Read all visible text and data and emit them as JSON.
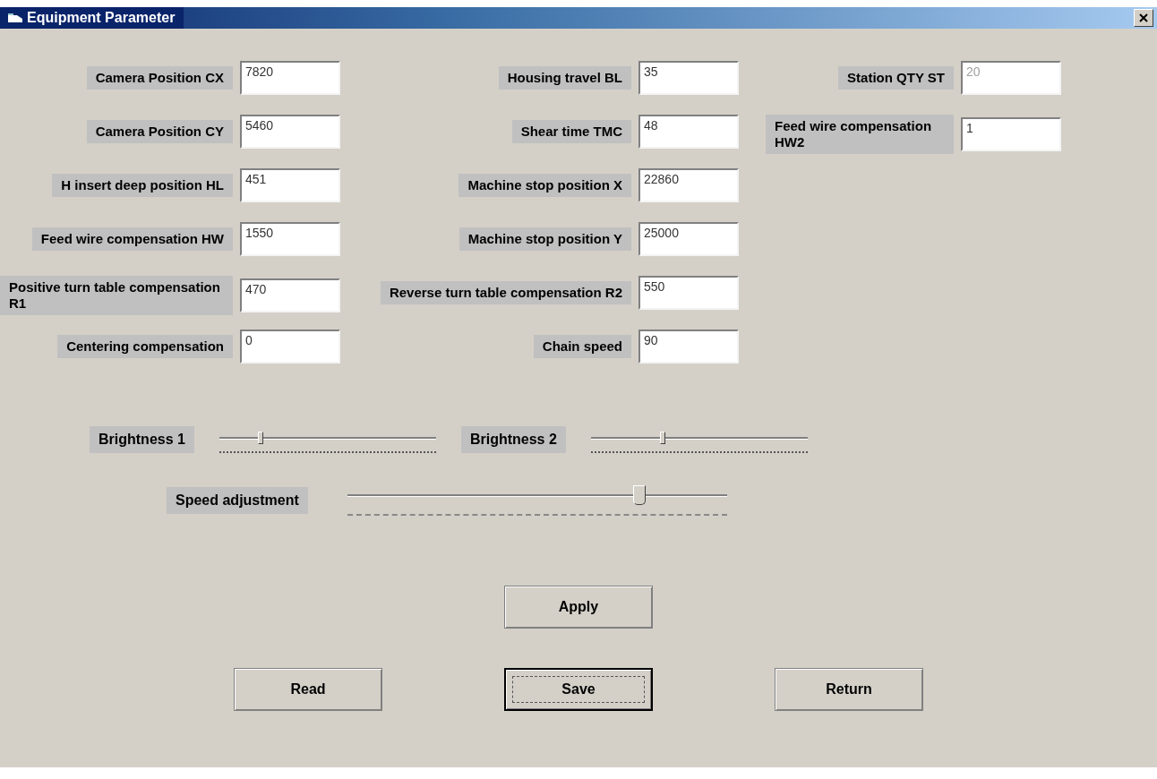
{
  "window": {
    "title": "Equipment Parameter"
  },
  "field_columns": [
    [
      {
        "label": "Camera Position  CX",
        "value": "7820",
        "disabled": false
      },
      {
        "label": "Camera Position  CY",
        "value": "5460",
        "disabled": false
      },
      {
        "label": "H insert deep position HL",
        "value": "451",
        "disabled": false
      },
      {
        "label": "Feed wire compensation HW",
        "value": "1550",
        "disabled": false
      },
      {
        "label": "Positive turn table compensation R1",
        "value": "470",
        "disabled": false
      },
      {
        "label": "Centering compensation",
        "value": "0",
        "disabled": false
      }
    ],
    [
      {
        "label": "Housing travel BL",
        "value": "35",
        "disabled": false
      },
      {
        "label": "Shear time TMC",
        "value": "48",
        "disabled": false
      },
      {
        "label": "Machine stop position X",
        "value": "22860",
        "disabled": false
      },
      {
        "label": "Machine stop position Y",
        "value": "25000",
        "disabled": false
      },
      {
        "label": "Reverse turn table compensation R2",
        "value": "550",
        "disabled": false
      },
      {
        "label": "Chain speed",
        "value": "90",
        "disabled": false
      }
    ],
    [
      {
        "label": "Station QTY ST",
        "value": "20",
        "disabled": true
      },
      {
        "label": "Feed wire compensation HW2",
        "value": "1",
        "disabled": false
      }
    ]
  ],
  "sliders": [
    {
      "label": "Brightness 1",
      "level": 0.19,
      "kind": "ticks"
    },
    {
      "label": "Brightness 2",
      "level": 0.33,
      "kind": "ticks"
    },
    {
      "label": "Speed adjustment",
      "level": 0.77,
      "kind": "large"
    }
  ],
  "buttons": [
    {
      "label": "Apply",
      "default": false
    },
    {
      "label": "Read",
      "default": false
    },
    {
      "label": "Save",
      "default": true
    },
    {
      "label": "Return",
      "default": false
    }
  ]
}
